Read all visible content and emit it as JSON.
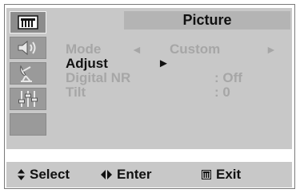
{
  "header": {
    "title": "Picture"
  },
  "sidebar": {
    "items": [
      {
        "icon": "picture-icon",
        "active": true
      },
      {
        "icon": "sound-icon",
        "active": false
      },
      {
        "icon": "antenna-icon",
        "active": false
      },
      {
        "icon": "settings-sliders-icon",
        "active": false
      },
      {
        "icon": "",
        "active": false
      }
    ]
  },
  "menu": {
    "mode": {
      "label": "Mode",
      "value": "Custom",
      "left_arrow": "◄",
      "right_arrow": "►"
    },
    "adjust": {
      "label": "Adjust",
      "arrow": "►"
    },
    "digital_nr": {
      "label": "Digital NR",
      "value": ": Off"
    },
    "tilt": {
      "label": "Tilt",
      "value": ": 0"
    }
  },
  "footer": {
    "select_label": "Select",
    "enter_label": "Enter",
    "exit_label": "Exit",
    "select_icon": "up-down-icon",
    "enter_icon": "left-right-icon",
    "exit_icon": "menu-icon"
  },
  "colors": {
    "panel": "#c8c8c8",
    "header": "#b4b4b4",
    "sidebar_button": "#9a9a9a",
    "text_active": "#111111",
    "text_dim": "#a6a6a6"
  }
}
